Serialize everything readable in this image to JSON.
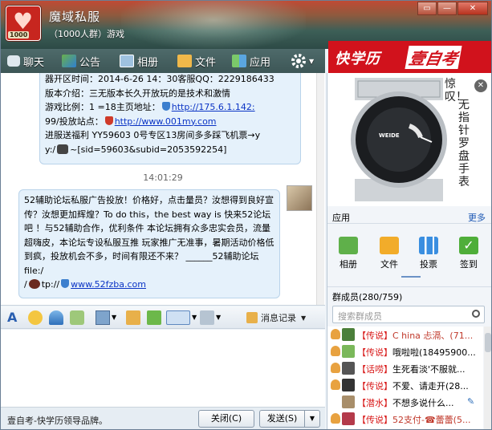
{
  "window": {
    "group_name": "魔域私服",
    "group_subtitle": "（1000人群）游戏",
    "avatar_badge": "1000",
    "controls": [
      "▭",
      "—",
      "✕"
    ]
  },
  "toolbar": {
    "chat": "聊天",
    "notice": "公告",
    "album": "相册",
    "files": "文件",
    "apps": "应用"
  },
  "ad_banner": {
    "brand_left": "快学历",
    "brand_right": "壹自考"
  },
  "chat": {
    "msg1_lines": [
      "器开区时间：2014-6-26 14：30客服QQ：2229186433",
      " 版本介绍：三无版本长久开放玩的是技术和激情",
      "游戏比例：1 =18主页地址：",
      "99/投放站点：",
      "进服送福利  YY59603 0号专区13房间多多踩飞机票→y",
      "y:/",
      "~[sid=59603&subid=2053592254]"
    ],
    "msg1_link1a": "http://175.6.1.142:",
    "msg1_link2": "http://www.001my.com",
    "timestamp": "14:01:29",
    "msg2_text": "52辅助论坛私服广告投放！价格好，点击量员？汝想得到良好宣传？汝想更加辉煌？To do this，the best way is 快来52论坛吧 ！与52辅助合作，优利条件 本论坛拥有众多忠实会员，流量超嗨皮，本论坛专设私服互推 玩家推广无准事，暑期活动价格低到疯，投放机会不多，时间有限还不来？  ______52辅助论坛    file:/",
    "msg2_tail_prefix": "/",
    "msg2_tail_mid": "tp://",
    "msg2_link": "www.52fzba.com"
  },
  "input_toolbar": {
    "history": "消息记录"
  },
  "footer": {
    "text": "壹自考-快学历领导品牌。",
    "close": "关闭(C)",
    "send": "发送(S)",
    "send_arrow": "▼"
  },
  "right_ad": {
    "wow": "惊叹！",
    "vertical": "无指针罗盘手表",
    "close": "✕",
    "watch_brand": "WEIDE"
  },
  "apps": {
    "title": "应用",
    "more": "更多",
    "items": [
      "相册",
      "文件",
      "投票",
      "签到"
    ]
  },
  "members": {
    "title": "群成员(280/759)",
    "search_placeholder": "搜索群成员",
    "rows": [
      {
        "tag": "【传说】",
        "name": "C hina 忐滆、(71..."
      },
      {
        "tag": "【传说】",
        "name": "哦啦啦(18495900..."
      },
      {
        "tag": "【话唠】",
        "name": "生死看淡'不服就..."
      },
      {
        "tag": "【传说】",
        "name": "不爱、请走开(28..."
      },
      {
        "tag": "【潜水】",
        "name": "不想多说什么..."
      },
      {
        "tag": "【传说】",
        "name": "52支付-☎蕾蕾(5..."
      }
    ]
  },
  "colors": {
    "accent_red": "#d1121c",
    "title_teal": "#3d5656",
    "link_blue": "#0b34c5",
    "bubble_bg": "#e5f1fb"
  }
}
